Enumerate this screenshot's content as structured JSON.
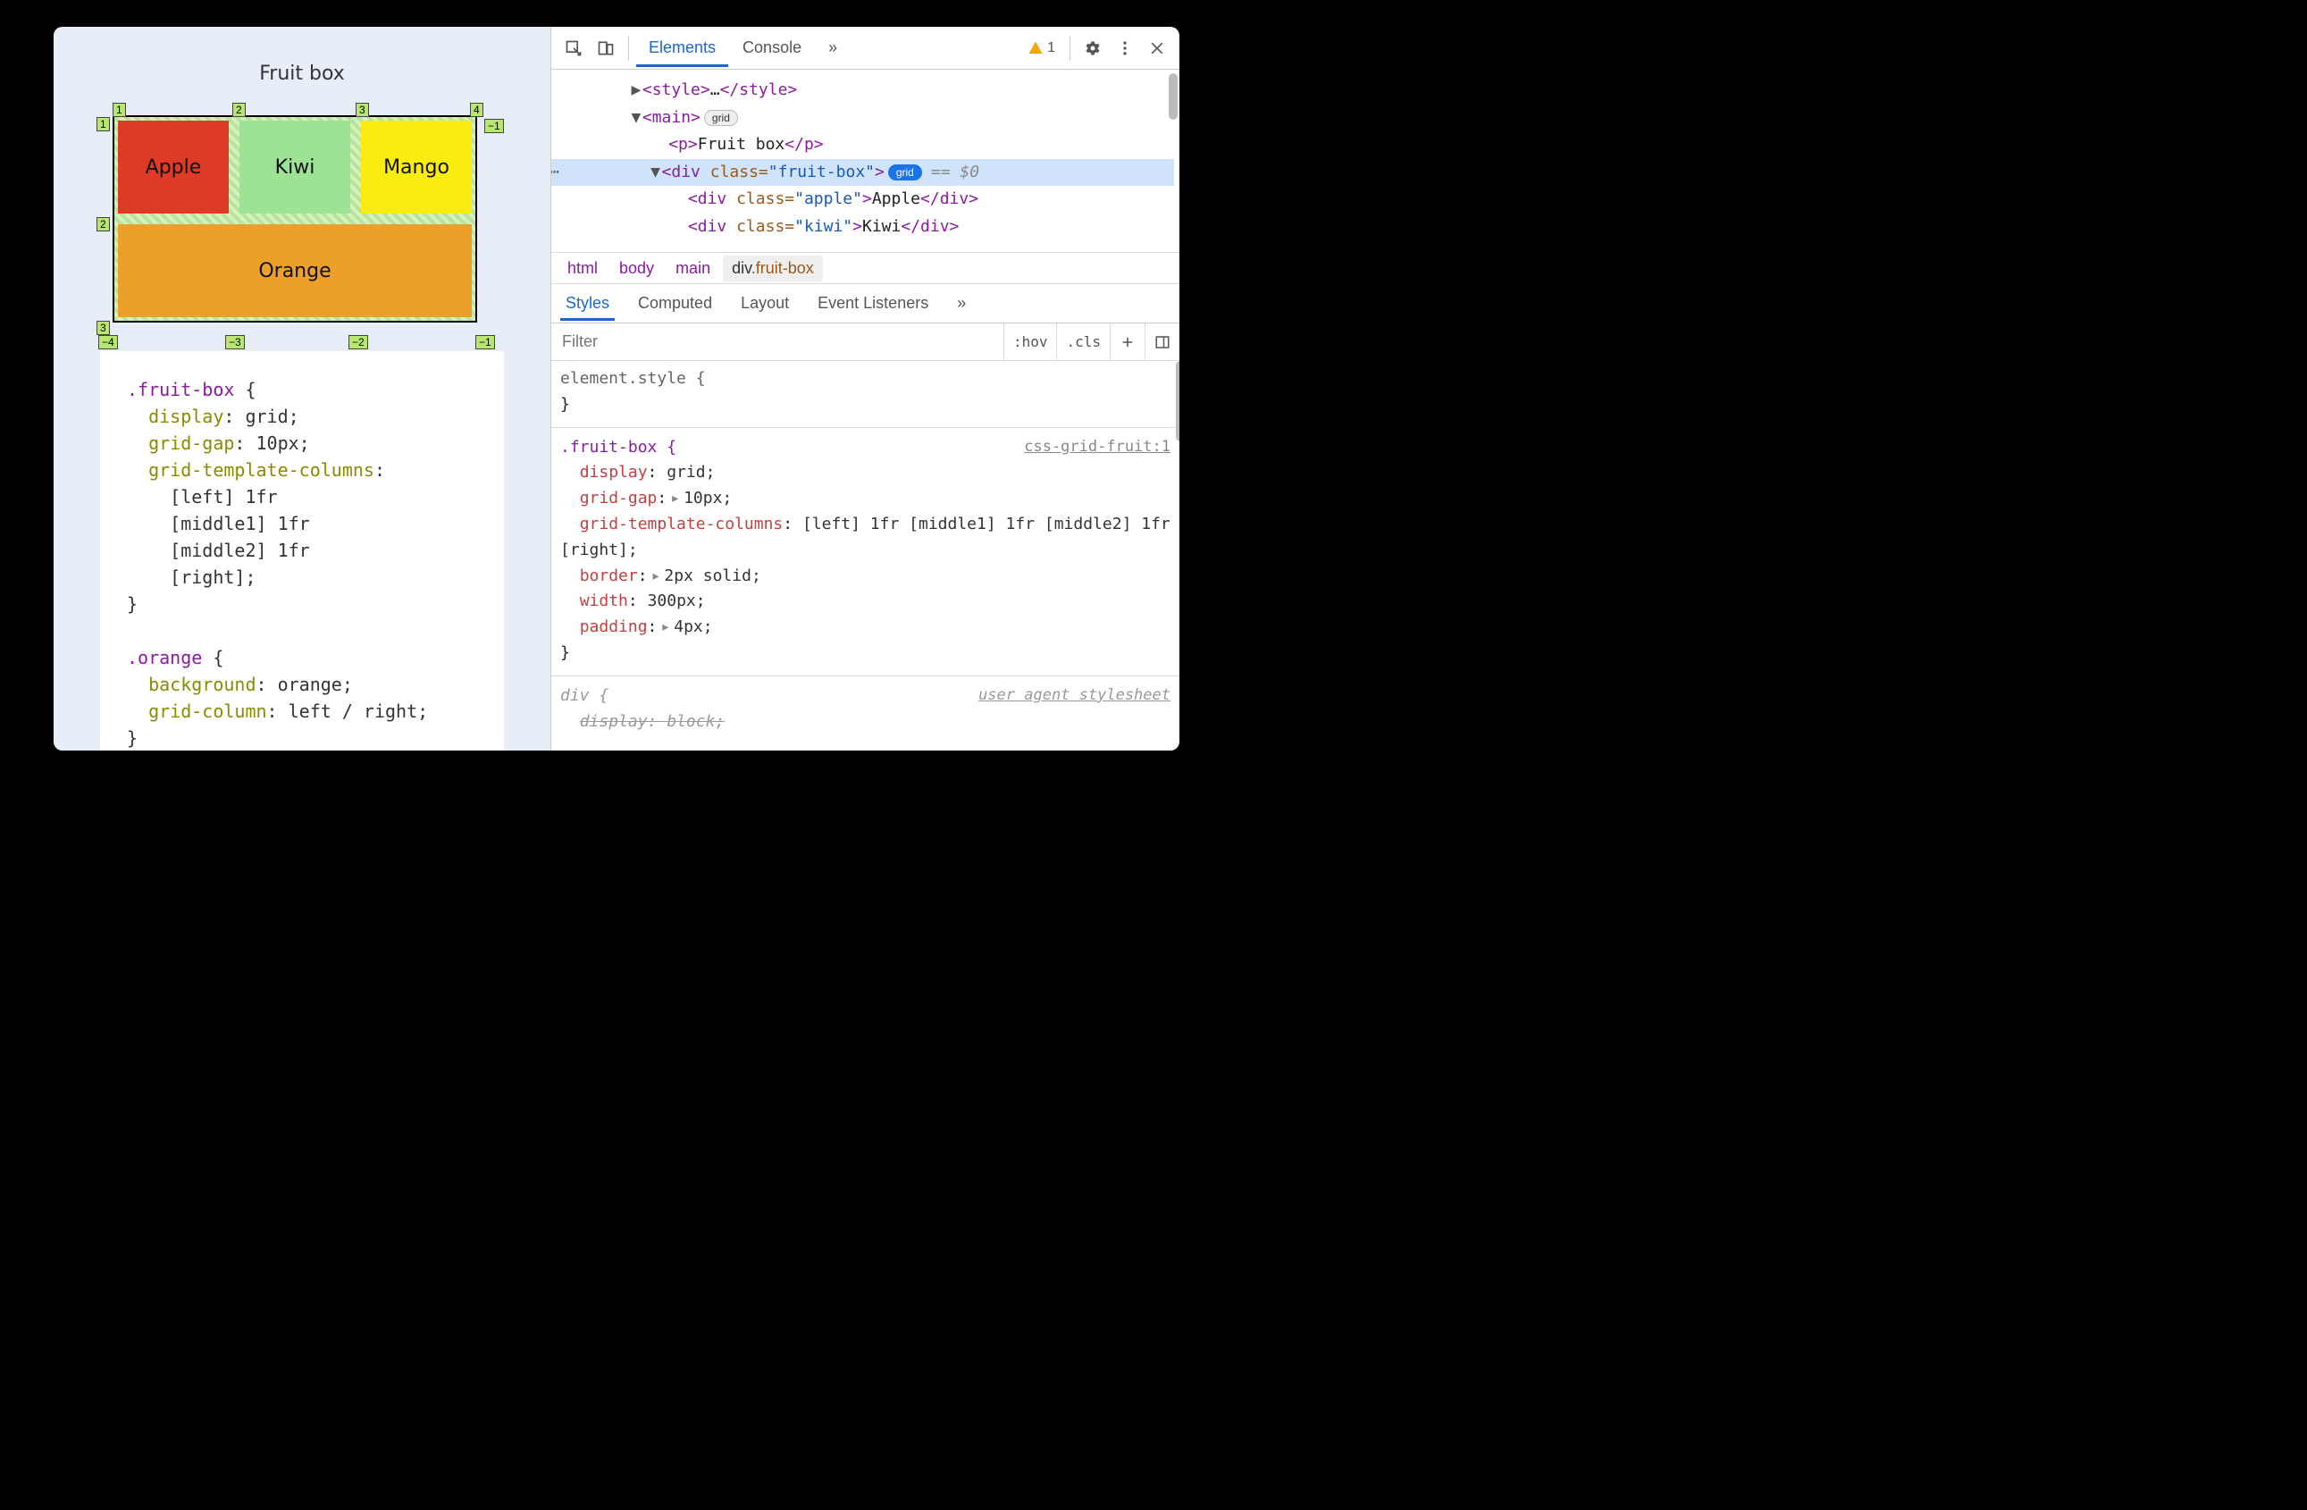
{
  "page": {
    "title": "Fruit box",
    "cells": {
      "apple": "Apple",
      "kiwi": "Kiwi",
      "mango": "Mango",
      "orange": "Orange"
    },
    "grid_numbers": {
      "top": [
        "1",
        "2",
        "3",
        "4"
      ],
      "left": [
        "1",
        "2"
      ],
      "bottom": [
        "−4",
        "−3",
        "−2",
        "−1"
      ],
      "rightcol": [
        "−1"
      ]
    },
    "code_css": ".fruit-box {\n  display: grid;\n  grid-gap: 10px;\n  grid-template-columns:\n    [left] 1fr\n    [middle1] 1fr\n    [middle2] 1fr\n    [right];\n}\n\n.orange {\n  background: orange;\n  grid-column: left / right;\n}"
  },
  "devtools": {
    "tabs": {
      "elements": "Elements",
      "console": "Console",
      "more": "»"
    },
    "warn_count": "1",
    "dom": {
      "style_open": "<style>",
      "style_ell": "…",
      "style_close": "</style>",
      "main_tag": "main",
      "main_badge": "grid",
      "p_text": "Fruit box",
      "div_tag": "div",
      "div_class_attr": "class=",
      "div_class_val": "\"fruit-box\"",
      "grid_pill": "grid",
      "eq": "== $0",
      "child1": "<div class=\"apple\">Apple</div>",
      "child2": "<div class=\"kiwi\">Kiwi</div>"
    },
    "crumbs": {
      "html": "html",
      "body": "body",
      "main": "main",
      "div": "div",
      "divcls": ".fruit-box"
    },
    "styles_tabs": {
      "styles": "Styles",
      "computed": "Computed",
      "layout": "Layout",
      "events": "Event Listeners",
      "more": "»"
    },
    "filter_placeholder": "Filter",
    "filter_btns": {
      "hov": ":hov",
      "cls": ".cls"
    },
    "rules": {
      "elstyle": "element.style {",
      "elstyle_close": "}",
      "fruit_selector": ".fruit-box {",
      "fruit_src": "css-grid-fruit:1",
      "display": "display",
      "display_v": "grid;",
      "gap": "grid-gap",
      "gap_v": "10px;",
      "cols": "grid-template-columns",
      "cols_v": "[left] 1fr [middle1] 1fr [middle2] 1fr [right];",
      "border": "border",
      "border_v": "2px solid;",
      "width": "width",
      "width_v": "300px;",
      "padding": "padding",
      "padding_v": "4px;",
      "close": "}",
      "div_sel": "div {",
      "uas": "user agent stylesheet",
      "div_disp": "display: block;"
    }
  }
}
